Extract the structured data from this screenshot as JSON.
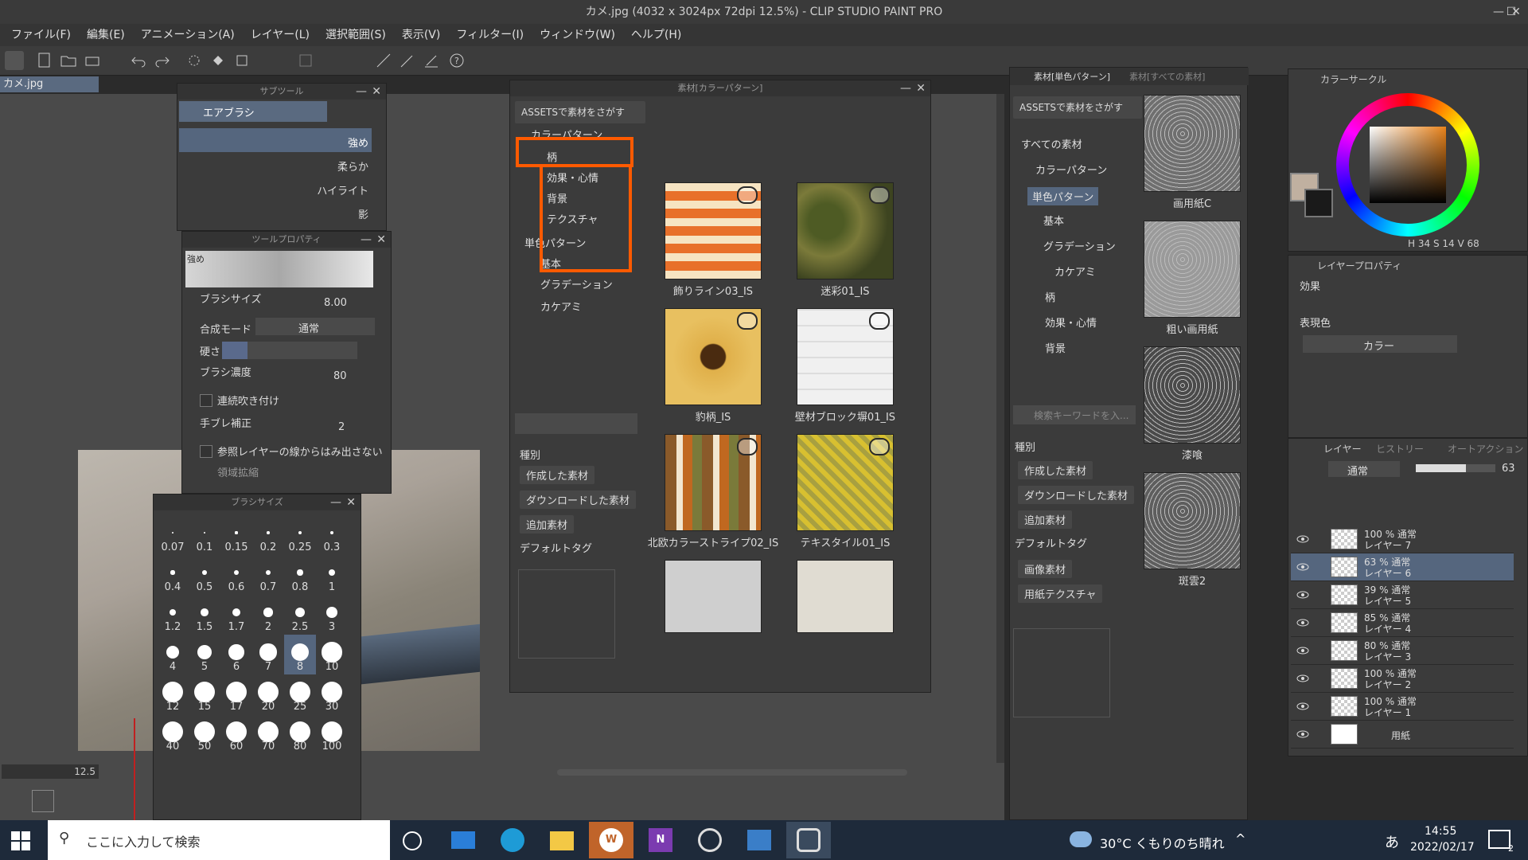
{
  "window": {
    "title": "カメ.jpg (4032 x 3024px 72dpi 12.5%) - CLIP STUDIO PAINT PRO"
  },
  "menu": [
    "ファイル(F)",
    "編集(E)",
    "アニメーション(A)",
    "レイヤー(L)",
    "選択範囲(S)",
    "表示(V)",
    "フィルター(I)",
    "ウィンドウ(W)",
    "ヘルプ(H)"
  ],
  "document_tab": "カメ.jpg",
  "subtool": {
    "title": "サブツール",
    "group": "エアブラシ",
    "items": [
      "強め",
      "柔らか",
      "ハイライト",
      "影"
    ]
  },
  "tool_property": {
    "title": "ツールプロパティ",
    "preview_label": "強め",
    "brush_size_label": "ブラシサイズ",
    "brush_size_value": "8.00",
    "blend_label": "合成モード",
    "blend_value": "通常",
    "hardness_label": "硬さ",
    "density_label": "ブラシ濃度",
    "density_value": "80",
    "continuous_label": "連続吹き付け",
    "stabilization_label": "手ブレ補正",
    "stabilization_value": "2",
    "reference_label": "参照レイヤーの線からはみ出さない",
    "expand_label": "領域拡縮"
  },
  "brush_size_panel": {
    "title": "ブラシサイズ",
    "sizes": [
      "0.07",
      "0.1",
      "0.15",
      "0.2",
      "0.25",
      "0.3",
      "0.4",
      "0.5",
      "0.6",
      "0.7",
      "0.8",
      "1",
      "1.2",
      "1.5",
      "1.7",
      "2",
      "2.5",
      "3",
      "4",
      "5",
      "6",
      "7",
      "8",
      "10",
      "12",
      "15",
      "17",
      "20",
      "25",
      "30",
      "40",
      "50",
      "60",
      "70",
      "80",
      "100"
    ],
    "selected": "8"
  },
  "zoom_value": "12.5",
  "material_left": {
    "title": "素材[カラーパターン]",
    "assets_button": "ASSETSで素材をさがす",
    "tree": [
      "カラーパターン",
      "柄",
      "効果・心情",
      "背景",
      "テクスチャ",
      "単色パターン",
      "基本",
      "グラデーション",
      "カケアミ"
    ],
    "thumbs": [
      "飾りライン03_IS",
      "迷彩01_IS",
      "豹柄_IS",
      "壁材ブロック塀01_IS",
      "北欧カラーストライプ02_IS",
      "テキスタイル01_IS"
    ],
    "filter_heading": "種別",
    "filters": [
      "作成した素材",
      "ダウンロードした素材",
      "追加素材",
      "デフォルトタグ"
    ]
  },
  "material_right": {
    "tab1": "素材[単色パターン]",
    "tab2": "素材[すべての素材]",
    "assets_button": "ASSETSで素材をさがす",
    "tree": [
      "すべての素材",
      "カラーパターン",
      "単色パターン",
      "基本",
      "グラデーション",
      "カケアミ",
      "柄",
      "効果・心情",
      "背景"
    ],
    "search_placeholder": "検索キーワードを入...",
    "filter_heading": "種別",
    "filters": [
      "作成した素材",
      "ダウンロードした素材",
      "追加素材",
      "デフォルトタグ",
      "画像素材",
      "用紙テクスチャ"
    ],
    "thumbs": [
      "画用紙C",
      "粗い画用紙",
      "漆喰",
      "斑雲2"
    ]
  },
  "color_circle": {
    "title": "カラーサークル",
    "h": "34",
    "s": "14",
    "v": "68"
  },
  "layer_property": {
    "title": "レイヤープロパティ",
    "effect_label": "効果",
    "expression_label": "表現色",
    "expression_value": "カラー"
  },
  "layers": {
    "tab_layer": "レイヤー",
    "tab_history": "ヒストリー",
    "tab_auto": "オートアクション",
    "blend": "通常",
    "opacity": "63",
    "items": [
      {
        "line1": "100 % 通常",
        "line2": "レイヤー 7"
      },
      {
        "line1": "63 % 通常",
        "line2": "レイヤー 6"
      },
      {
        "line1": "39 % 通常",
        "line2": "レイヤー 5"
      },
      {
        "line1": "85 % 通常",
        "line2": "レイヤー 4"
      },
      {
        "line1": "80 % 通常",
        "line2": "レイヤー 3"
      },
      {
        "line1": "100 % 通常",
        "line2": "レイヤー 2"
      },
      {
        "line1": "100 % 通常",
        "line2": "レイヤー 1"
      },
      {
        "line1": "",
        "line2": "用紙"
      }
    ]
  },
  "taskbar": {
    "search_placeholder": "ここに入力して検索",
    "weather": "30°C くもりのち晴れ",
    "ime": "あ",
    "time": "14:55",
    "date": "2022/02/17",
    "notifications": "2"
  }
}
